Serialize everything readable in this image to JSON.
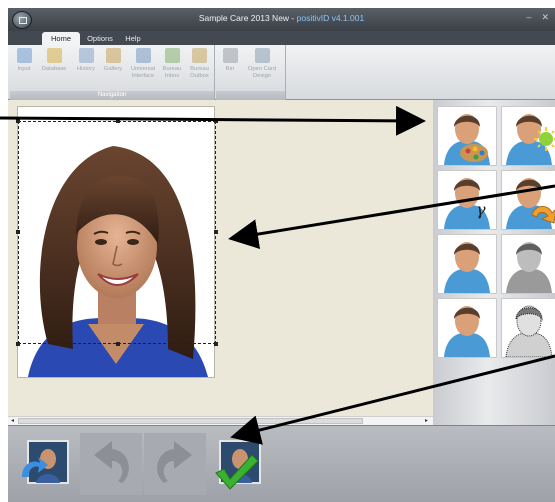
{
  "window": {
    "title_main": "Sample Care 2013 New - ",
    "title_version": "positivID v4.1.001",
    "controls": {
      "minimize": "–",
      "close": "✕"
    }
  },
  "tabs": [
    {
      "label": "Home",
      "active": true
    },
    {
      "label": "Options",
      "active": false
    },
    {
      "label": "Help",
      "active": false
    }
  ],
  "ribbon": {
    "navigation_group": {
      "caption": "Navigation",
      "buttons": [
        {
          "label": "Input",
          "icon": "input-icon",
          "color": "#6f9ccf"
        },
        {
          "label": "Database",
          "icon": "database-icon",
          "color": "#d6b14a"
        },
        {
          "label": "History",
          "icon": "history-icon",
          "color": "#8aa6c8"
        },
        {
          "label": "Gallery",
          "icon": "gallery-icon",
          "color": "#c9a35a"
        },
        {
          "label": "Universal\nInterface",
          "icon": "universal-interface-icon",
          "color": "#7a99c4"
        },
        {
          "label": "Bureau\nInbox",
          "icon": "bureau-inbox-icon",
          "color": "#86b070"
        },
        {
          "label": "Bureau\nOutbox",
          "icon": "bureau-outbox-icon",
          "color": "#c7a860"
        }
      ]
    },
    "card_group": {
      "buttons": [
        {
          "label": "Bin",
          "icon": "bin-icon",
          "color": "#9aa0a6"
        },
        {
          "label": "Open Card\nDesign",
          "icon": "open-card-design-icon",
          "color": "#8aa0b4"
        }
      ]
    }
  },
  "palette": {
    "buttons": [
      {
        "name": "color-adjust-button",
        "icon": "person-palette-icon"
      },
      {
        "name": "brightness-button",
        "icon": "person-brightness-icon"
      },
      {
        "name": "gamma-button",
        "icon": "person-gamma-icon"
      },
      {
        "name": "rotate-button",
        "icon": "person-rotate-icon"
      },
      {
        "name": "auto-enhance-button",
        "icon": "person-auto-icon"
      },
      {
        "name": "grayscale-button",
        "icon": "person-grayscale-icon"
      },
      {
        "name": "reset-button",
        "icon": "person-default-icon"
      },
      {
        "name": "sketch-button",
        "icon": "person-sketch-icon"
      }
    ]
  },
  "bottom_toolbar": {
    "buttons": [
      {
        "name": "reload-photo-button",
        "icon": "reload-photo-icon"
      },
      {
        "name": "undo-button",
        "icon": "undo-icon"
      },
      {
        "name": "redo-button",
        "icon": "redo-icon"
      },
      {
        "name": "accept-photo-button",
        "icon": "accept-photo-icon"
      }
    ]
  },
  "scrollbar": {
    "left_arrow": "◂",
    "right_arrow": "▸"
  }
}
